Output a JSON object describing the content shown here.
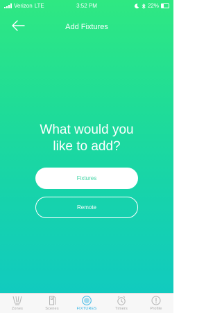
{
  "status_bar": {
    "carrier": "Verizon",
    "network": "LTE",
    "time": "3:52 PM",
    "battery": "22%"
  },
  "nav": {
    "title": "Add Fixtures",
    "back_icon": "arrow-left-icon"
  },
  "main": {
    "prompt": "What would you\nlike to add?",
    "primary_button": "Fixtures",
    "secondary_button": "Remote"
  },
  "tabs": [
    {
      "label": "Zones",
      "icon": "zones-icon"
    },
    {
      "label": "Scenes",
      "icon": "scenes-icon"
    },
    {
      "label": "FIXTURES",
      "icon": "fixtures-icon",
      "active": true
    },
    {
      "label": "Timers",
      "icon": "timer-icon"
    },
    {
      "label": "Profile",
      "icon": "profile-icon"
    }
  ],
  "colors": {
    "gradient_top": "#2fe882",
    "gradient_bottom": "#10c9c3",
    "active_tab": "#35b5e5",
    "inactive_tab": "#a7a7a7",
    "button_text": "#3fd4a3"
  }
}
